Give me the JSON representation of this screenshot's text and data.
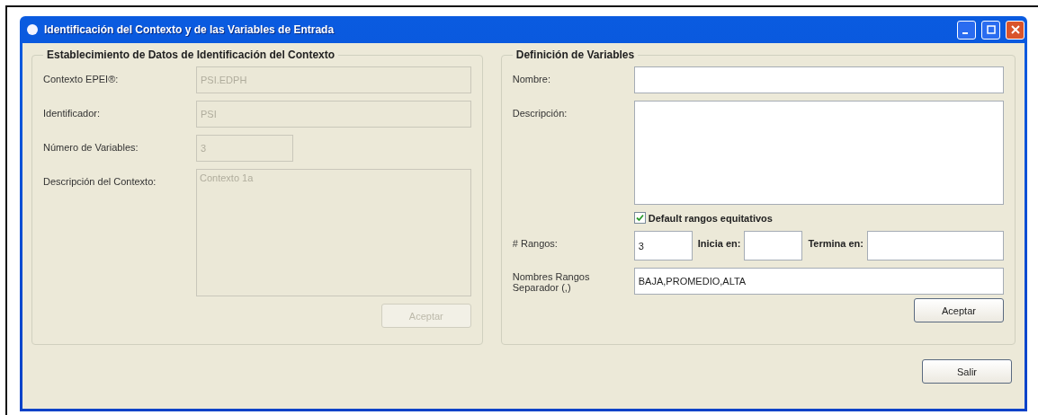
{
  "window": {
    "title": "Identificación del Contexto y de las Variables de Entrada"
  },
  "context_group": {
    "title": "Establecimiento de Datos de Identificación del Contexto",
    "disabled": true,
    "fields": [
      {
        "kind": "line",
        "label": "Contexto EPEI®:",
        "value": "PSI.EDPH"
      },
      {
        "kind": "line",
        "label": "Identificador:",
        "value": "PSI"
      },
      {
        "kind": "short",
        "label": "Número de Variables:",
        "value": "3"
      },
      {
        "kind": "area",
        "label": "Descripción del Contexto:",
        "value": "Contexto 1a"
      }
    ],
    "button": "Aceptar"
  },
  "variables_group": {
    "title": "Definición de Variables",
    "name": {
      "label": "Nombre:"
    },
    "description": {
      "label": "Descripción:"
    },
    "default_ranges": {
      "label": "Default rangos equitativos",
      "checked": true
    },
    "ranges": {
      "label": "# Rangos:",
      "value": "3",
      "start_label": "Inicia en:",
      "end_label": "Termina en:"
    },
    "range_names": {
      "label": "Nombres Rangos Separador (,)",
      "value": "BAJA,PROMEDIO,ALTA"
    },
    "button": "Aceptar"
  },
  "exit_button": "Salir"
}
